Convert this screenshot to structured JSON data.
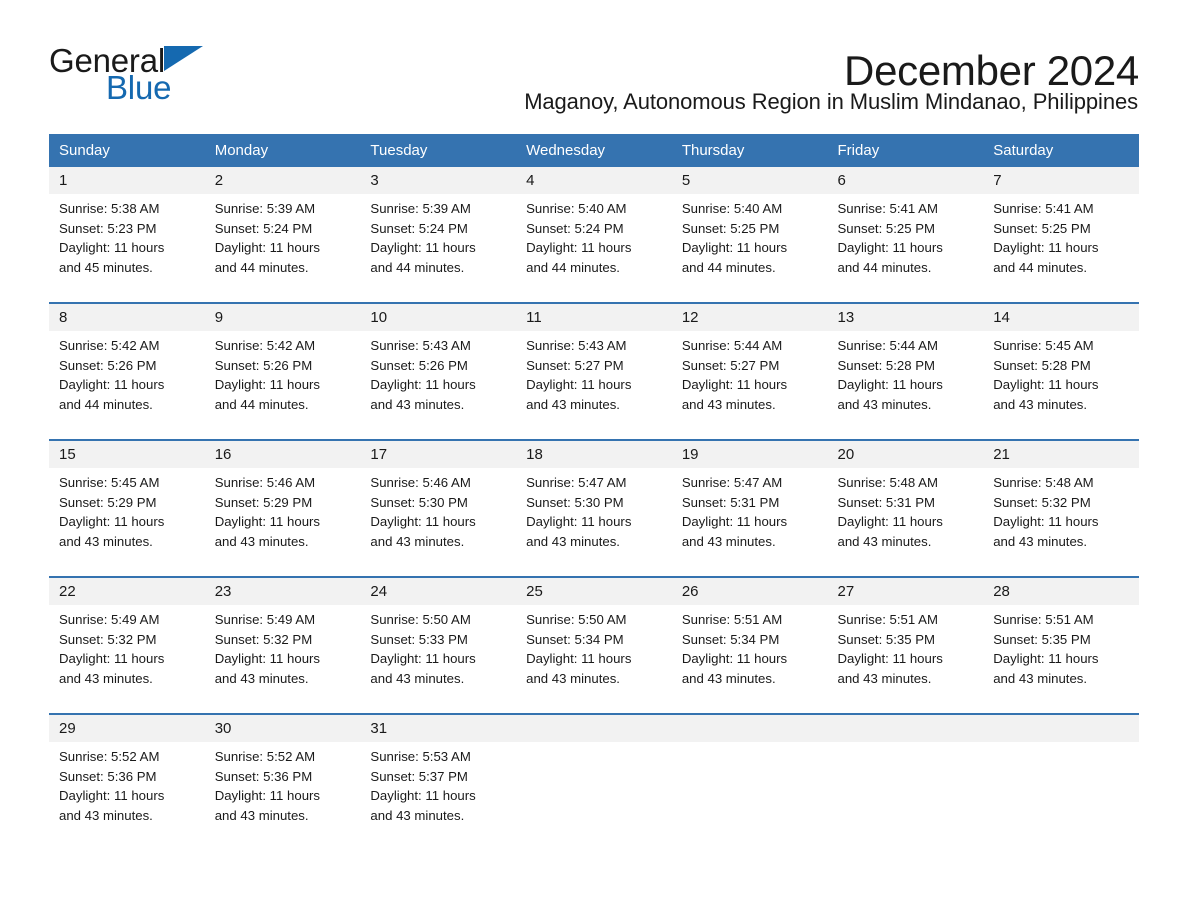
{
  "brand": {
    "name_part1": "General",
    "name_part2": "Blue",
    "accent_color": "#1569b0"
  },
  "header": {
    "title": "December 2024",
    "subtitle": "Maganoy, Autonomous Region in Muslim Mindanao, Philippines"
  },
  "theme": {
    "header_blue": "#3573b0",
    "daynum_gray": "#f2f2f2",
    "text": "#1a1a1a"
  },
  "weekdays": [
    "Sunday",
    "Monday",
    "Tuesday",
    "Wednesday",
    "Thursday",
    "Friday",
    "Saturday"
  ],
  "weeks": [
    [
      {
        "day": "1",
        "sunrise": "Sunrise: 5:38 AM",
        "sunset": "Sunset: 5:23 PM",
        "daylight_1": "Daylight: 11 hours",
        "daylight_2": "and 45 minutes."
      },
      {
        "day": "2",
        "sunrise": "Sunrise: 5:39 AM",
        "sunset": "Sunset: 5:24 PM",
        "daylight_1": "Daylight: 11 hours",
        "daylight_2": "and 44 minutes."
      },
      {
        "day": "3",
        "sunrise": "Sunrise: 5:39 AM",
        "sunset": "Sunset: 5:24 PM",
        "daylight_1": "Daylight: 11 hours",
        "daylight_2": "and 44 minutes."
      },
      {
        "day": "4",
        "sunrise": "Sunrise: 5:40 AM",
        "sunset": "Sunset: 5:24 PM",
        "daylight_1": "Daylight: 11 hours",
        "daylight_2": "and 44 minutes."
      },
      {
        "day": "5",
        "sunrise": "Sunrise: 5:40 AM",
        "sunset": "Sunset: 5:25 PM",
        "daylight_1": "Daylight: 11 hours",
        "daylight_2": "and 44 minutes."
      },
      {
        "day": "6",
        "sunrise": "Sunrise: 5:41 AM",
        "sunset": "Sunset: 5:25 PM",
        "daylight_1": "Daylight: 11 hours",
        "daylight_2": "and 44 minutes."
      },
      {
        "day": "7",
        "sunrise": "Sunrise: 5:41 AM",
        "sunset": "Sunset: 5:25 PM",
        "daylight_1": "Daylight: 11 hours",
        "daylight_2": "and 44 minutes."
      }
    ],
    [
      {
        "day": "8",
        "sunrise": "Sunrise: 5:42 AM",
        "sunset": "Sunset: 5:26 PM",
        "daylight_1": "Daylight: 11 hours",
        "daylight_2": "and 44 minutes."
      },
      {
        "day": "9",
        "sunrise": "Sunrise: 5:42 AM",
        "sunset": "Sunset: 5:26 PM",
        "daylight_1": "Daylight: 11 hours",
        "daylight_2": "and 44 minutes."
      },
      {
        "day": "10",
        "sunrise": "Sunrise: 5:43 AM",
        "sunset": "Sunset: 5:26 PM",
        "daylight_1": "Daylight: 11 hours",
        "daylight_2": "and 43 minutes."
      },
      {
        "day": "11",
        "sunrise": "Sunrise: 5:43 AM",
        "sunset": "Sunset: 5:27 PM",
        "daylight_1": "Daylight: 11 hours",
        "daylight_2": "and 43 minutes."
      },
      {
        "day": "12",
        "sunrise": "Sunrise: 5:44 AM",
        "sunset": "Sunset: 5:27 PM",
        "daylight_1": "Daylight: 11 hours",
        "daylight_2": "and 43 minutes."
      },
      {
        "day": "13",
        "sunrise": "Sunrise: 5:44 AM",
        "sunset": "Sunset: 5:28 PM",
        "daylight_1": "Daylight: 11 hours",
        "daylight_2": "and 43 minutes."
      },
      {
        "day": "14",
        "sunrise": "Sunrise: 5:45 AM",
        "sunset": "Sunset: 5:28 PM",
        "daylight_1": "Daylight: 11 hours",
        "daylight_2": "and 43 minutes."
      }
    ],
    [
      {
        "day": "15",
        "sunrise": "Sunrise: 5:45 AM",
        "sunset": "Sunset: 5:29 PM",
        "daylight_1": "Daylight: 11 hours",
        "daylight_2": "and 43 minutes."
      },
      {
        "day": "16",
        "sunrise": "Sunrise: 5:46 AM",
        "sunset": "Sunset: 5:29 PM",
        "daylight_1": "Daylight: 11 hours",
        "daylight_2": "and 43 minutes."
      },
      {
        "day": "17",
        "sunrise": "Sunrise: 5:46 AM",
        "sunset": "Sunset: 5:30 PM",
        "daylight_1": "Daylight: 11 hours",
        "daylight_2": "and 43 minutes."
      },
      {
        "day": "18",
        "sunrise": "Sunrise: 5:47 AM",
        "sunset": "Sunset: 5:30 PM",
        "daylight_1": "Daylight: 11 hours",
        "daylight_2": "and 43 minutes."
      },
      {
        "day": "19",
        "sunrise": "Sunrise: 5:47 AM",
        "sunset": "Sunset: 5:31 PM",
        "daylight_1": "Daylight: 11 hours",
        "daylight_2": "and 43 minutes."
      },
      {
        "day": "20",
        "sunrise": "Sunrise: 5:48 AM",
        "sunset": "Sunset: 5:31 PM",
        "daylight_1": "Daylight: 11 hours",
        "daylight_2": "and 43 minutes."
      },
      {
        "day": "21",
        "sunrise": "Sunrise: 5:48 AM",
        "sunset": "Sunset: 5:32 PM",
        "daylight_1": "Daylight: 11 hours",
        "daylight_2": "and 43 minutes."
      }
    ],
    [
      {
        "day": "22",
        "sunrise": "Sunrise: 5:49 AM",
        "sunset": "Sunset: 5:32 PM",
        "daylight_1": "Daylight: 11 hours",
        "daylight_2": "and 43 minutes."
      },
      {
        "day": "23",
        "sunrise": "Sunrise: 5:49 AM",
        "sunset": "Sunset: 5:32 PM",
        "daylight_1": "Daylight: 11 hours",
        "daylight_2": "and 43 minutes."
      },
      {
        "day": "24",
        "sunrise": "Sunrise: 5:50 AM",
        "sunset": "Sunset: 5:33 PM",
        "daylight_1": "Daylight: 11 hours",
        "daylight_2": "and 43 minutes."
      },
      {
        "day": "25",
        "sunrise": "Sunrise: 5:50 AM",
        "sunset": "Sunset: 5:34 PM",
        "daylight_1": "Daylight: 11 hours",
        "daylight_2": "and 43 minutes."
      },
      {
        "day": "26",
        "sunrise": "Sunrise: 5:51 AM",
        "sunset": "Sunset: 5:34 PM",
        "daylight_1": "Daylight: 11 hours",
        "daylight_2": "and 43 minutes."
      },
      {
        "day": "27",
        "sunrise": "Sunrise: 5:51 AM",
        "sunset": "Sunset: 5:35 PM",
        "daylight_1": "Daylight: 11 hours",
        "daylight_2": "and 43 minutes."
      },
      {
        "day": "28",
        "sunrise": "Sunrise: 5:51 AM",
        "sunset": "Sunset: 5:35 PM",
        "daylight_1": "Daylight: 11 hours",
        "daylight_2": "and 43 minutes."
      }
    ],
    [
      {
        "day": "29",
        "sunrise": "Sunrise: 5:52 AM",
        "sunset": "Sunset: 5:36 PM",
        "daylight_1": "Daylight: 11 hours",
        "daylight_2": "and 43 minutes."
      },
      {
        "day": "30",
        "sunrise": "Sunrise: 5:52 AM",
        "sunset": "Sunset: 5:36 PM",
        "daylight_1": "Daylight: 11 hours",
        "daylight_2": "and 43 minutes."
      },
      {
        "day": "31",
        "sunrise": "Sunrise: 5:53 AM",
        "sunset": "Sunset: 5:37 PM",
        "daylight_1": "Daylight: 11 hours",
        "daylight_2": "and 43 minutes."
      },
      {
        "day": "",
        "sunrise": "",
        "sunset": "",
        "daylight_1": "",
        "daylight_2": ""
      },
      {
        "day": "",
        "sunrise": "",
        "sunset": "",
        "daylight_1": "",
        "daylight_2": ""
      },
      {
        "day": "",
        "sunrise": "",
        "sunset": "",
        "daylight_1": "",
        "daylight_2": ""
      },
      {
        "day": "",
        "sunrise": "",
        "sunset": "",
        "daylight_1": "",
        "daylight_2": ""
      }
    ]
  ]
}
